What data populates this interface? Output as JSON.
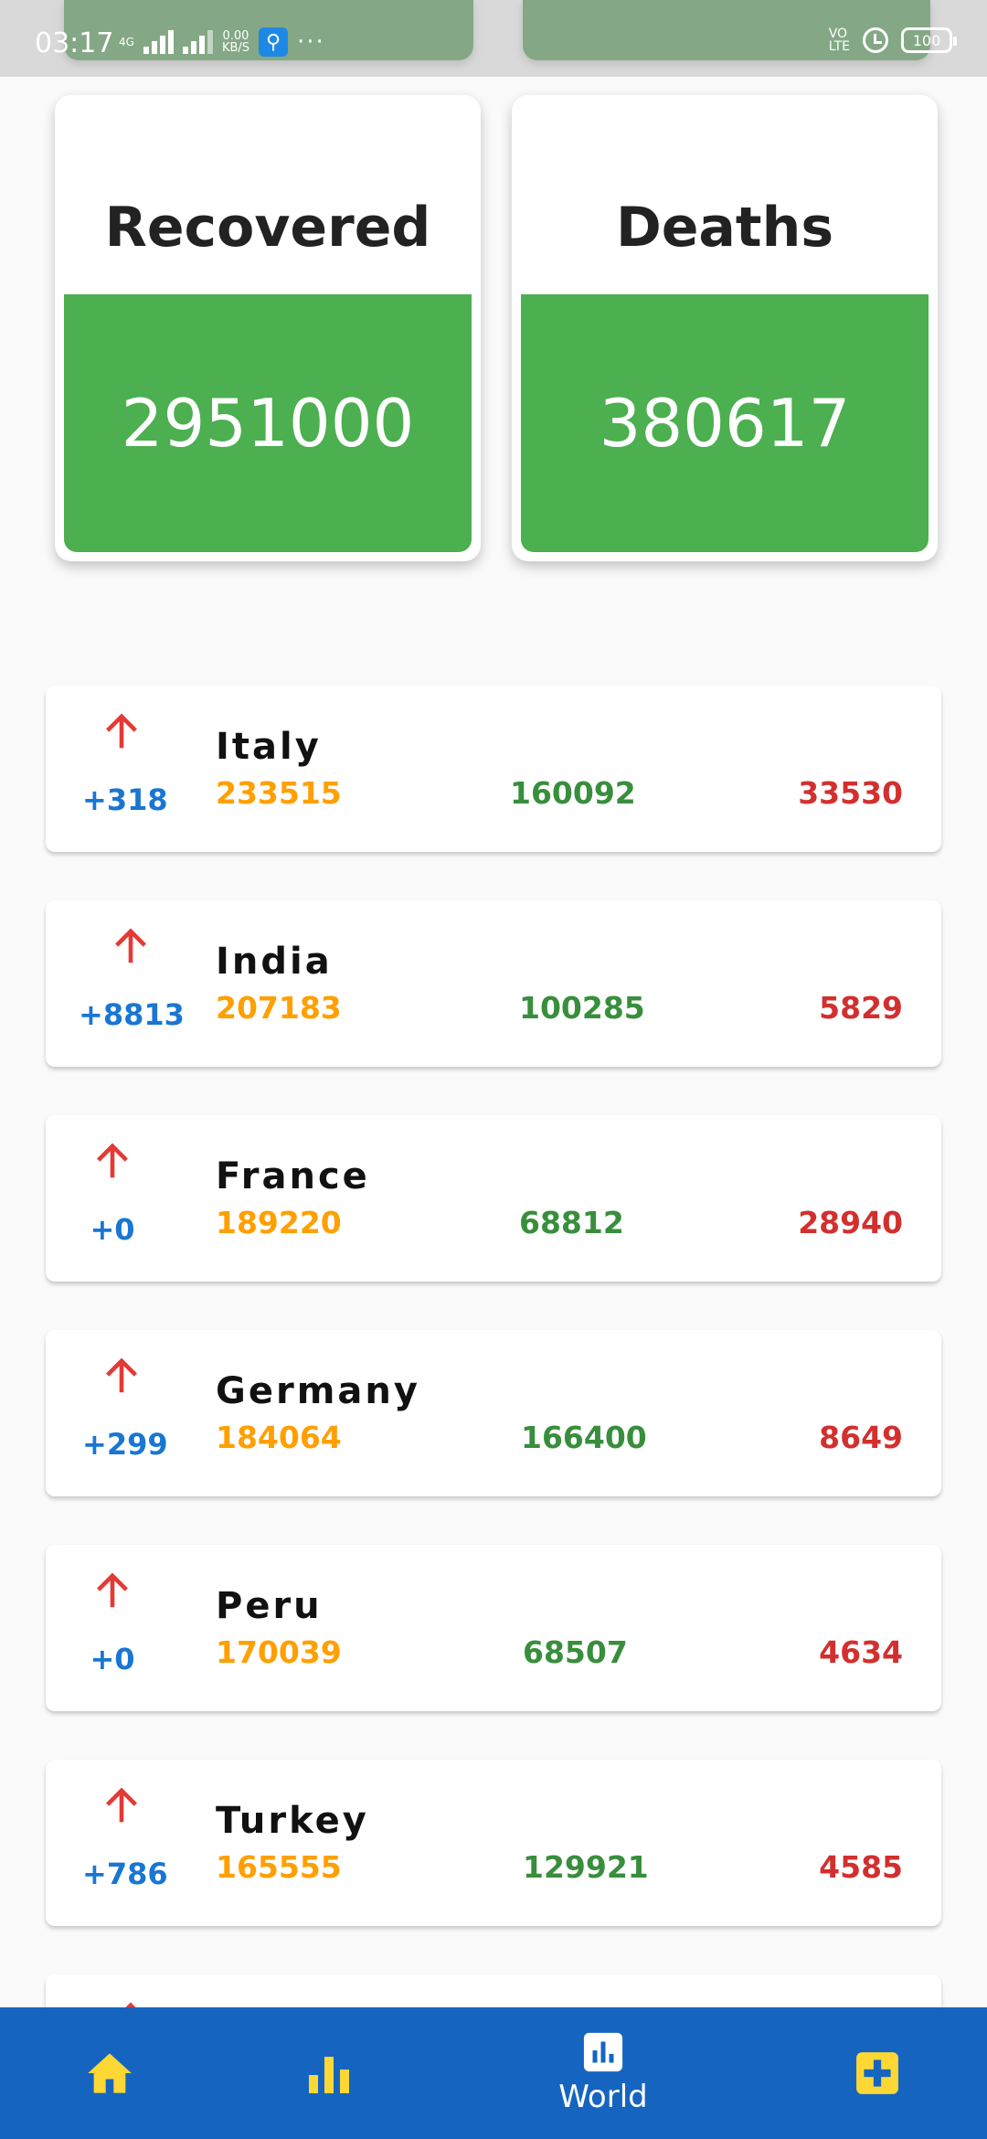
{
  "status_bar": {
    "time": "03:17",
    "network": "4G",
    "speed_value": "0.00",
    "speed_unit": "KB/S",
    "volte_top": "VO",
    "volte_bottom": "LTE",
    "battery": "100"
  },
  "summary": {
    "recovered": {
      "title": "Recovered",
      "value": "2951000"
    },
    "deaths": {
      "title": "Deaths",
      "value": "380617"
    }
  },
  "countries": [
    {
      "name": "Italy",
      "delta": "+318",
      "confirmed": "233515",
      "recovered": "160092",
      "deaths": "33530"
    },
    {
      "name": "India",
      "delta": "+8813",
      "confirmed": "207183",
      "recovered": "100285",
      "deaths": "5829"
    },
    {
      "name": "France",
      "delta": "+0",
      "confirmed": "189220",
      "recovered": "68812",
      "deaths": "28940"
    },
    {
      "name": "Germany",
      "delta": "+299",
      "confirmed": "184064",
      "recovered": "166400",
      "deaths": "8649"
    },
    {
      "name": "Peru",
      "delta": "+0",
      "confirmed": "170039",
      "recovered": "68507",
      "deaths": "4634"
    },
    {
      "name": "Turkey",
      "delta": "+786",
      "confirmed": "165555",
      "recovered": "129921",
      "deaths": "4585"
    }
  ],
  "nav": {
    "world_label": "World",
    "icons": [
      "home-icon",
      "bar-chart-icon",
      "world-chart-icon",
      "plus-icon"
    ],
    "icon_color": "#fdd835",
    "background": "#1565c0"
  },
  "colors": {
    "card_green": "#4caf50",
    "confirmed": "#ff9f00",
    "recovered": "#388e3c",
    "deaths": "#d32f2f",
    "delta": "#1976d2",
    "arrow": "#e53935"
  }
}
